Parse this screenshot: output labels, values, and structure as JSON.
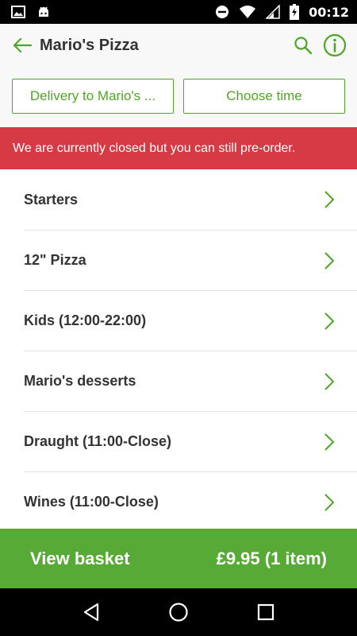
{
  "status_bar": {
    "time": "00:12",
    "icons": [
      "image-icon",
      "android-icon",
      "do-not-disturb-icon",
      "wifi-icon",
      "signal-icon",
      "battery-charging-icon"
    ]
  },
  "header": {
    "title": "Mario's Pizza",
    "back_icon": "back-arrow-icon",
    "actions": [
      "search-icon",
      "info-icon"
    ],
    "delivery_button": "Delivery to Mario's ...",
    "time_button": "Choose time"
  },
  "banner": {
    "text": "We are currently closed but you can still pre-order."
  },
  "menu": {
    "items": [
      {
        "label": "Starters"
      },
      {
        "label": "12\" Pizza"
      },
      {
        "label": "Kids (12:00-22:00)"
      },
      {
        "label": "Mario's desserts"
      },
      {
        "label": "Draught (11:00-Close)"
      },
      {
        "label": "Wines (11:00-Close)"
      }
    ]
  },
  "basket": {
    "label": "View basket",
    "total": "£9.95 (1 item)"
  },
  "nav": {
    "icons": [
      "back-triangle-icon",
      "home-circle-icon",
      "recents-square-icon"
    ]
  },
  "colors": {
    "brand_green": "#4fa626",
    "basket_green": "#58aa36",
    "banner_red": "#d63a44",
    "header_bg": "#f8f8f8"
  }
}
